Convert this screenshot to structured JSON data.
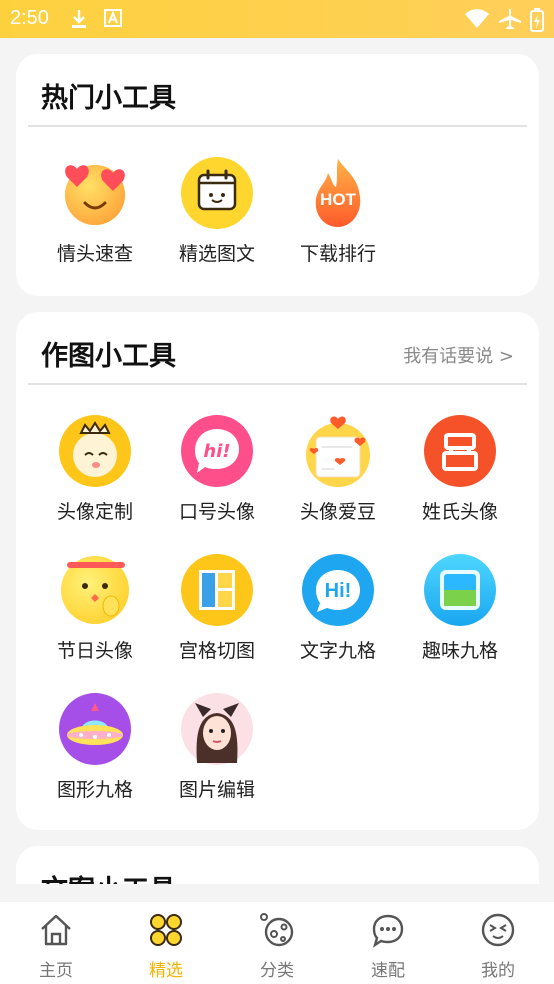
{
  "status_bar": {
    "time": "2:50"
  },
  "hot_tools": {
    "title": "热门小工具",
    "items": [
      {
        "label": "情头速查",
        "icon": "heart-eyes-face-icon"
      },
      {
        "label": "精选图文",
        "icon": "calendar-icon"
      },
      {
        "label": "下载排行",
        "icon": "hot-flame-icon"
      }
    ]
  },
  "drawing_tools": {
    "title": "作图小工具",
    "link": "我有话要说 >",
    "items": [
      {
        "label": "头像定制",
        "icon": "crown-face-icon"
      },
      {
        "label": "口号头像",
        "icon": "hi-bubble-icon"
      },
      {
        "label": "头像爱豆",
        "icon": "hearts-avatar-icon"
      },
      {
        "label": "姓氏头像",
        "icon": "surname-icon"
      },
      {
        "label": "节日头像",
        "icon": "holiday-face-icon"
      },
      {
        "label": "宫格切图",
        "icon": "grid-cut-icon"
      },
      {
        "label": "文字九格",
        "icon": "hi-text-icon"
      },
      {
        "label": "趣味九格",
        "icon": "landscape-stamp-icon"
      },
      {
        "label": "图形九格",
        "icon": "ufo-icon"
      },
      {
        "label": "图片编辑",
        "icon": "photo-portrait-icon"
      }
    ]
  },
  "copy_tools": {
    "title": "文案小工具"
  },
  "tabbar": {
    "tabs": [
      {
        "label": "主页",
        "icon": "home-icon"
      },
      {
        "label": "精选",
        "icon": "clover-icon",
        "active": true
      },
      {
        "label": "分类",
        "icon": "category-icon"
      },
      {
        "label": "速配",
        "icon": "chat-bubble-icon"
      },
      {
        "label": "我的",
        "icon": "face-icon"
      }
    ]
  },
  "colors": {
    "accent": "#f3b300",
    "status_bar": "#fdd13e"
  }
}
